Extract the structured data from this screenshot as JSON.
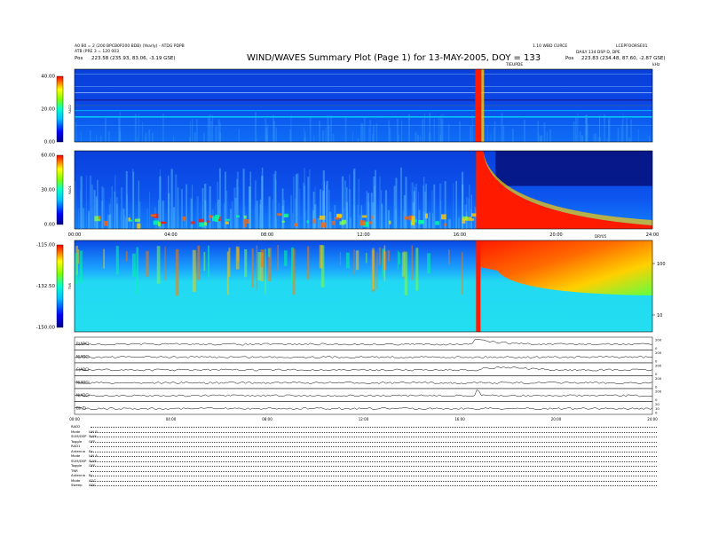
{
  "header": {
    "title": "WIND/WAVES Summary Plot (Page 1) for 13-MAY-2005, DOY = 133",
    "left_line1": "A0 B0 = 2 (200 BPCB0P200 BDB) (Yearly) - ATDG PDPB",
    "left_line2": "ATB (PRE 3 = 120 003",
    "left_pos_label": "Pos",
    "left_pos_value": "223.58 (235.93, 83.06, -3.19 GSE)",
    "right_line1": "1.10 WBD CURCE",
    "right_line1b": "LCEPFOORSE01",
    "right_line2": "DAILY 134 DSP D, DPE",
    "right_pos_label": "Pos",
    "right_pos_value": "223.83 (234.48, 87.60, -2.87 GSE)",
    "top_marker_right": "TIEUPDE",
    "top_marker_far_right": "kHz"
  },
  "chart_data": [
    {
      "type": "heatmap",
      "name": "RAD2",
      "ylabel": "RAD2",
      "colorbar_ticks": [
        "40.00",
        "20.00",
        "0.00"
      ],
      "colorbar_range": [
        0,
        40
      ],
      "events": [
        {
          "time_hours": 16.75,
          "label": "burst"
        }
      ]
    },
    {
      "type": "heatmap",
      "name": "RAD1",
      "ylabel": "RAD1",
      "colorbar_ticks": [
        "60.00",
        "30.00",
        "0.00"
      ],
      "colorbar_range": [
        0,
        60
      ],
      "events": [
        {
          "time_hours": 16.75,
          "label": "type III burst with decay"
        }
      ],
      "xticks": [
        "00:00",
        "04:00",
        "08:00",
        "12:00",
        "16:00",
        "20:00",
        "24:00"
      ],
      "xtick_hours": [
        0,
        4,
        8,
        12,
        16,
        20,
        24
      ],
      "x_right_label": "DRY05"
    },
    {
      "type": "heatmap",
      "name": "TNR",
      "ylabel": "TNR",
      "colorbar_ticks": [
        "-115.00",
        "-132.50",
        "-150.00"
      ],
      "colorbar_range": [
        -150,
        -115
      ],
      "right_axis_ticks": [
        "100",
        "10"
      ],
      "events": [
        {
          "time_hours": 16.75,
          "label": "intense burst"
        }
      ]
    },
    {
      "type": "line",
      "panels": [
        {
          "label": "B(ADC)",
          "right_ticks": [
            "200",
            "0"
          ]
        },
        {
          "label": "N(ADC)",
          "right_ticks": [
            "200",
            "0"
          ]
        },
        {
          "label": "C(ADC)",
          "right_ticks": [
            "200",
            "0"
          ]
        },
        {
          "label": "N(ADC)",
          "right_ticks": [
            "200",
            "0"
          ]
        },
        {
          "label": "N(ADC)",
          "right_ticks": [
            "200",
            "0"
          ]
        },
        {
          "label": "B(nT)",
          "right_ticks": [
            "20",
            "10",
            "0"
          ]
        }
      ],
      "xticks": [
        "00:00",
        "04:00",
        "08:00",
        "12:00",
        "16:00",
        "20:00",
        "24:00"
      ]
    }
  ],
  "status_rows": [
    {
      "k": "RAD2",
      "v": ""
    },
    {
      "k": "Mode",
      "v": "LIN B"
    },
    {
      "k": "SUM/DSP",
      "v": "SUM"
    },
    {
      "k": "Toggle",
      "v": "OFF"
    },
    {
      "k": "RAD1",
      "v": ""
    },
    {
      "k": "Antenna",
      "v": "Ex"
    },
    {
      "k": "Mode",
      "v": "LIN A"
    },
    {
      "k": "SUM/DSP",
      "v": "SUM"
    },
    {
      "k": "Toggle",
      "v": "OFF"
    },
    {
      "k": "TNR",
      "v": ""
    },
    {
      "k": "Antenna",
      "v": "Ey"
    },
    {
      "k": "Mode",
      "v": "AGC"
    },
    {
      "k": "Sweep",
      "v": "ADC"
    }
  ]
}
